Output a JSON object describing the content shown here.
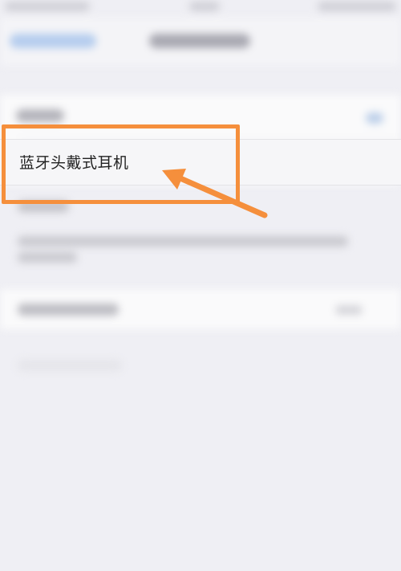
{
  "device": {
    "name_label": "蓝牙头戴式耳机"
  },
  "annotation": {
    "color": "#f58f3c"
  },
  "colors": {
    "background": "#efeff4",
    "card": "#fafafb",
    "accent_blue": "#b5cdee"
  }
}
